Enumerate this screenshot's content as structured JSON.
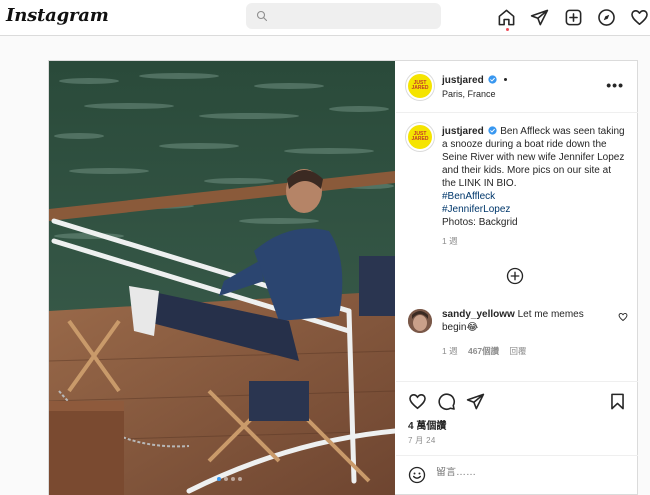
{
  "app": {
    "logo": "Instagram"
  },
  "topbar": {
    "search_placeholder": "",
    "icons": [
      "home-icon",
      "direct-icon",
      "new-post-icon",
      "explore-icon",
      "activity-heart-icon"
    ]
  },
  "post": {
    "author": "justjared",
    "avatar_text": "JUST JARED",
    "location": "Paris, France",
    "more_label": "•••",
    "caption_text": "Ben Affleck was seen taking a snooze during a boat ride down the Seine River with new wife Jennifer Lopez and their kids. More pics on our site at the LINK IN BIO.",
    "hashtags": [
      "#BenAffleck",
      "#JenniferLopez"
    ],
    "credit": "Photos: Backgrid",
    "caption_age": "1 週",
    "likes": "4 萬個讚",
    "date": "7 月 24",
    "add_comment_placeholder": "留言……",
    "carousel_index": 1,
    "carousel_count": 4
  },
  "comment": {
    "user": "sandy_yelloww",
    "text": "Let me memes begin😂",
    "age": "1 週",
    "likes": "467個讚",
    "reply_label": "回覆"
  },
  "colors": {
    "link": "#00376b",
    "verified": "#3897f0",
    "brand_yellow": "#f5e400",
    "notification_dot": "#ed4956"
  }
}
